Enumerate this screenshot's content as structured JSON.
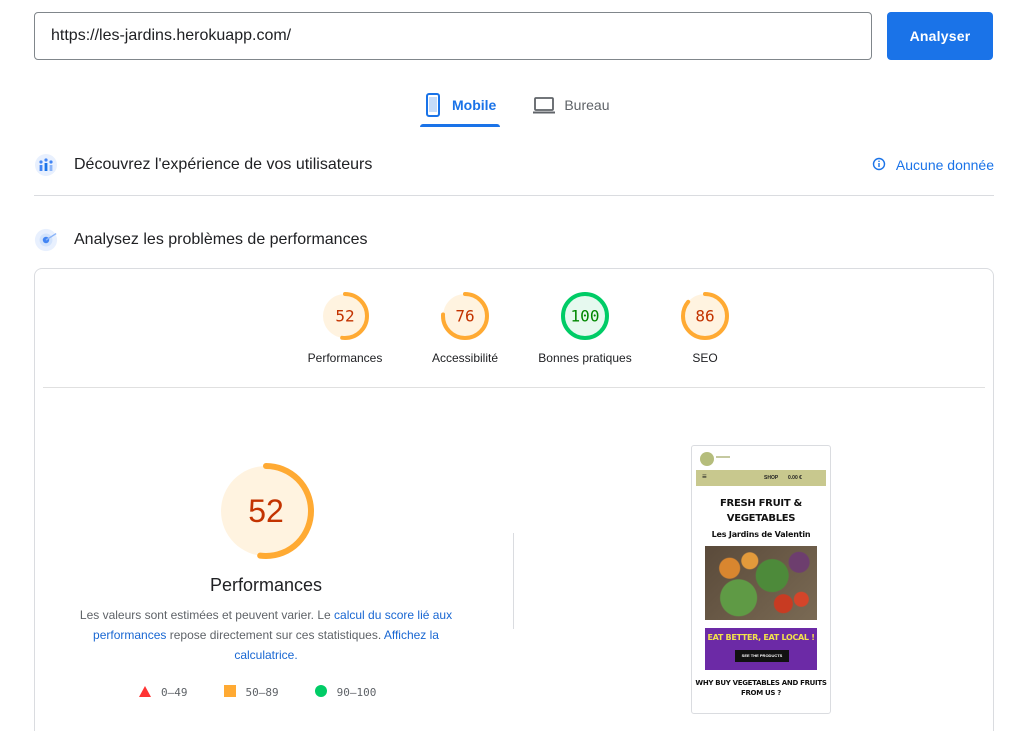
{
  "search": {
    "url_value": "https://les-jardins.herokuapp.com/",
    "analyze_label": "Analyser"
  },
  "device_tabs": [
    {
      "label": "Mobile",
      "icon": "smartphone-icon",
      "active": true
    },
    {
      "label": "Bureau",
      "icon": "laptop-icon",
      "active": false
    }
  ],
  "field_section": {
    "title": "Découvrez l'expérience de vos utilisateurs",
    "icon": "users-chart-icon",
    "status_label": "Aucune donnée",
    "status_icon": "info-icon"
  },
  "lab_section": {
    "title": "Analysez les problèmes de performances",
    "icon": "lab-target-icon"
  },
  "categories": [
    {
      "score": 52,
      "label": "Performances",
      "color": "#fa3",
      "text_color": "#c33300",
      "fill": "#fff3e0"
    },
    {
      "score": 76,
      "label": "Accessibilité",
      "color": "#fa3",
      "text_color": "#c33300",
      "fill": "#fff3e0"
    },
    {
      "score": 100,
      "label": "Bonnes pratiques",
      "color": "#0c6",
      "text_color": "#008800",
      "fill": "#e6f9ef"
    },
    {
      "score": 86,
      "label": "SEO",
      "color": "#fa3",
      "text_color": "#c33300",
      "fill": "#fff3e0"
    }
  ],
  "main_gauge": {
    "score": 52,
    "title": "Performances",
    "color": "#fa3",
    "text_color": "#c33300",
    "fill": "#fff3e0"
  },
  "description": {
    "text1": "Les valeurs sont estimées et peuvent varier. Le ",
    "link1": "calcul du score lié aux performances",
    "text2": " repose directement sur ces statistiques. ",
    "link2": "Affichez la calculatrice."
  },
  "legend": [
    {
      "range": "0–49",
      "shape": "triangle",
      "color": "#f33"
    },
    {
      "range": "50–89",
      "shape": "square",
      "color": "#fa3"
    },
    {
      "range": "90–100",
      "shape": "circle",
      "color": "#0c6"
    }
  ],
  "screenshot": {
    "nav_menu": "≡",
    "nav_shop": "SHOP",
    "nav_cart": "0.00 €",
    "heading": "FRESH FRUIT & VEGETABLES",
    "subheading": "Les Jardins de Valentin",
    "banner_text": "EAT BETTER, EAT LOCAL !",
    "banner_button": "SEE THE PRODUCTS",
    "section_heading": "WHY BUY VEGETABLES AND FRUITS FROM US ?"
  }
}
